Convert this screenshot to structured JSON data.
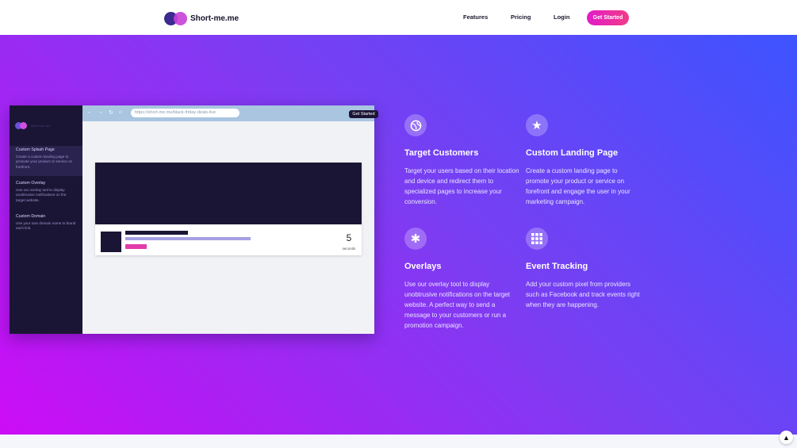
{
  "brand": {
    "name": "Short-me.me"
  },
  "nav": {
    "links": [
      "Features",
      "Pricing",
      "Login"
    ],
    "cta": "Get Started"
  },
  "mockup": {
    "sidebar_logo_text": "Short-me.me",
    "sidebar_items": [
      {
        "title": "Custom Splash Page",
        "desc": "Create a custom landing page to promote your product or service on forefront."
      },
      {
        "title": "Custom Overlay",
        "desc": "Use our overlay tool to display unobtrusive notifications on the target website."
      },
      {
        "title": "Custom Domain",
        "desc": "Use your own domain name to brand each link."
      }
    ],
    "url": "https://short-me.me/black-friday-deals-live",
    "cta": "Get Started",
    "countdown": {
      "value": "5",
      "unit": "seconds"
    }
  },
  "features": [
    {
      "icon": "globe-icon",
      "title": "Target Customers",
      "desc": "Target your users based on their location and device and redirect them to specialized pages to increase your conversion."
    },
    {
      "icon": "star-icon",
      "title": "Custom Landing Page",
      "desc": "Create a custom landing page to promote your product or service on forefront and engage the user in your marketing campaign."
    },
    {
      "icon": "asterisk-icon",
      "title": "Overlays",
      "desc": "Use our overlay tool to display unobtrusive notifications on the target website. A perfect way to send a message to your customers or run a promotion campaign."
    },
    {
      "icon": "grid-icon",
      "title": "Event Tracking",
      "desc": "Add your custom pixel from providers such as Facebook and track events right when they are happening."
    }
  ],
  "colors": {
    "accent": "#e11cc8",
    "hero_start": "#cc0cf5",
    "hero_end": "#3d54ff",
    "dark": "#1b1535"
  }
}
